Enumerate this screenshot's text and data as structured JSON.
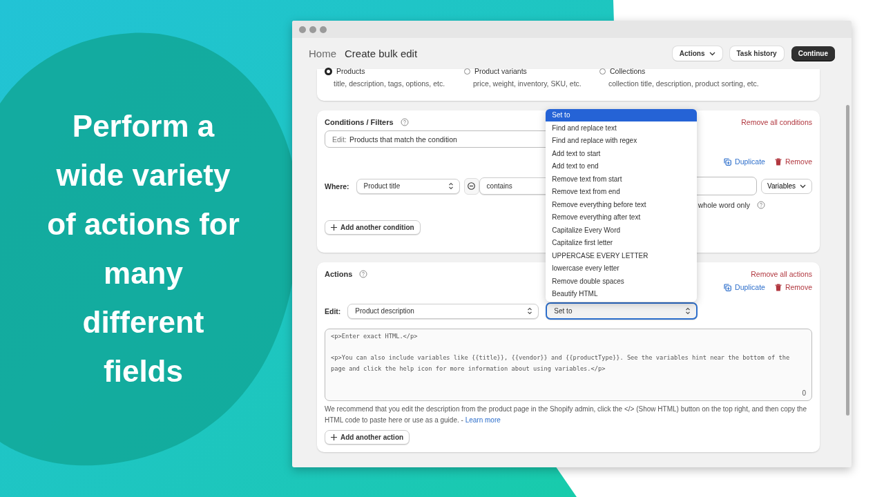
{
  "headline": "Perform a wide variety of actions for many different fields",
  "window": {
    "breadcrumb": "Home",
    "title": "Create bulk edit",
    "buttons": [
      {
        "label": "Actions",
        "kind": "menu"
      },
      {
        "label": "Task history",
        "kind": "secondary"
      },
      {
        "label": "Continue",
        "kind": "primary"
      }
    ]
  },
  "edit_types": [
    {
      "label": "Products",
      "hint": "title, description, tags, options, etc.",
      "selected": true
    },
    {
      "label": "Product variants",
      "hint": "price, weight, inventory, SKU, etc.",
      "selected": false
    },
    {
      "label": "Collections",
      "hint": "collection title, description, product sorting, etc.",
      "selected": false
    }
  ],
  "conditions": {
    "title": "Conditions / Filters",
    "remove_all": "Remove all conditions",
    "filter_field": {
      "label": "Edit:",
      "value": "Products that match the condition"
    },
    "duplicate": "Duplicate",
    "remove": "Remove",
    "where_label": "Where:",
    "field_select": "Product title",
    "operator_select": "contains",
    "variables_button": "Variables",
    "whole_word_label": "whole word only",
    "add_button": "Add another condition"
  },
  "actions": {
    "title": "Actions",
    "remove_all": "Remove all actions",
    "duplicate": "Duplicate",
    "remove": "Remove",
    "edit_label": "Edit:",
    "field_select": "Product description",
    "operation_select": "Set to",
    "operation_menu": [
      {
        "label": "Set to",
        "selected": true
      },
      {
        "label": "Find and replace text",
        "selected": false
      },
      {
        "label": "Find and replace with regex",
        "selected": false
      },
      {
        "label": "Add text to start",
        "selected": false
      },
      {
        "label": "Add text to end",
        "selected": false
      },
      {
        "label": "Remove text from start",
        "selected": false
      },
      {
        "label": "Remove text from end",
        "selected": false
      },
      {
        "label": "Remove everything before text",
        "selected": false
      },
      {
        "label": "Remove everything after text",
        "selected": false
      },
      {
        "label": "Capitalize Every Word",
        "selected": false
      },
      {
        "label": "Capitalize first letter",
        "selected": false
      },
      {
        "label": "UPPERCASE EVERY LETTER",
        "selected": false
      },
      {
        "label": "lowercase every letter",
        "selected": false
      },
      {
        "label": "Remove double spaces",
        "selected": false
      },
      {
        "label": "Beautify HTML",
        "selected": false
      }
    ],
    "editor": {
      "placeholder": "<p>Enter exact HTML.</p>\n\n<p>You can also include variables like {{title}}, {{vendor}} and {{productType}}. See the variables hint near the bottom of the page and click the help icon for more information about using variables.</p>",
      "counter": "0"
    },
    "help_text": "We recommend that you edit the description from the product page in the Shopify admin, click the </> (Show HTML) button on the top right, and then copy the HTML code to paste here or use as a guide. -",
    "help_link": "Learn more",
    "add_button": "Add another action"
  }
}
